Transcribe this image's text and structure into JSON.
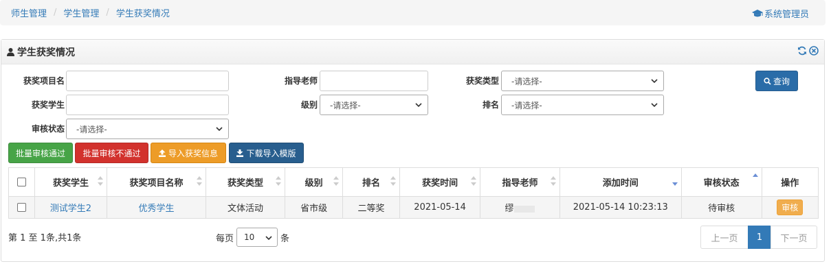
{
  "breadcrumb": {
    "items": [
      "师生管理",
      "学生管理",
      "学生获奖情况"
    ],
    "admin_label": "系统管理员"
  },
  "panel": {
    "title": "学生获奖情况"
  },
  "form": {
    "award_project_label": "获奖项目名",
    "award_student_label": "获奖学生",
    "review_status_label": "审核状态",
    "advisor_label": "指导老师",
    "level_label": "级别",
    "award_type_label": "获奖类型",
    "rank_label": "排名",
    "select_placeholder": "-请选择-",
    "query_label": "查询"
  },
  "actions": {
    "batch_approve": "批量审核通过",
    "batch_reject": "批量审核不通过",
    "import": "导入获奖信息",
    "download_template": "下载导入模版"
  },
  "table": {
    "headers": [
      "获奖学生",
      "获奖项目名称",
      "获奖类型",
      "级别",
      "排名",
      "获奖时间",
      "指导老师",
      "添加时间",
      "审核状态",
      "操作"
    ],
    "rows": [
      {
        "student": "测试学生2",
        "project": "优秀学生",
        "type": "文体活动",
        "level": "省市级",
        "rank": "二等奖",
        "award_date": "2021-05-14",
        "advisor": "缪",
        "added": "2021-05-14 10:23:13",
        "status": "待审核",
        "action": "审核"
      }
    ]
  },
  "footer": {
    "summary": "第 1 至 1条,共1条",
    "per_page_prefix": "每页",
    "per_page_value": "10",
    "per_page_suffix": "条",
    "prev": "上一页",
    "current_page": "1",
    "next": "下一页"
  },
  "colors": {
    "link": "#337ab7",
    "green": "#47a447",
    "red": "#d2322d",
    "orange": "#ed9c28",
    "blue": "#285e8e"
  }
}
